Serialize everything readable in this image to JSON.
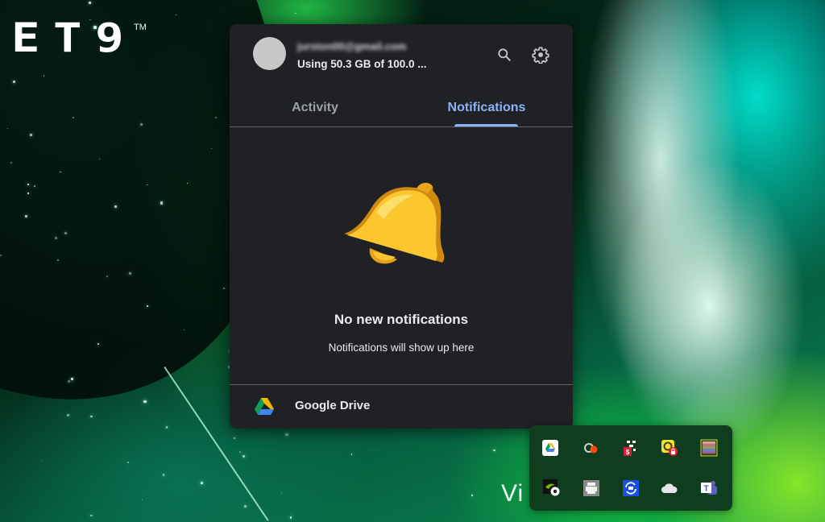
{
  "desktop": {
    "brand_logo": "ET9",
    "brand_tm": "TM",
    "partial_text": "Vi"
  },
  "drive_panel": {
    "account": {
      "email": "jurston00@gmail.com",
      "storage_text": "Using 50.3 GB of 100.0 ..."
    },
    "header_icons": [
      "search-icon",
      "gear-icon"
    ],
    "tabs": [
      {
        "label": "Activity",
        "selected": false
      },
      {
        "label": "Notifications",
        "selected": true
      }
    ],
    "empty_state": {
      "icon": "bell-icon",
      "title": "No new notifications",
      "subtitle": "Notifications will show up here"
    },
    "footer": {
      "icon": "google-drive-icon",
      "label": "Google Drive"
    },
    "colors": {
      "panel_bg": "#202124",
      "accent": "#8ab4f8",
      "text": "#e8eaed",
      "muted_text": "#9aa0a6"
    }
  },
  "system_tray": {
    "icons": [
      {
        "name": "google-drive-tray-icon",
        "row": 1
      },
      {
        "name": "creative-cloud-sync-icon",
        "row": 1
      },
      {
        "name": "dropbox-alert-icon",
        "row": 1
      },
      {
        "name": "norton-locked-icon",
        "row": 1
      },
      {
        "name": "color-palette-app-icon",
        "row": 1
      },
      {
        "name": "nvidia-settings-icon",
        "row": 2
      },
      {
        "name": "printer-icon",
        "row": 2
      },
      {
        "name": "sync-app-icon",
        "row": 2
      },
      {
        "name": "onedrive-icon",
        "row": 2
      },
      {
        "name": "microsoft-teams-icon",
        "row": 2
      }
    ]
  }
}
